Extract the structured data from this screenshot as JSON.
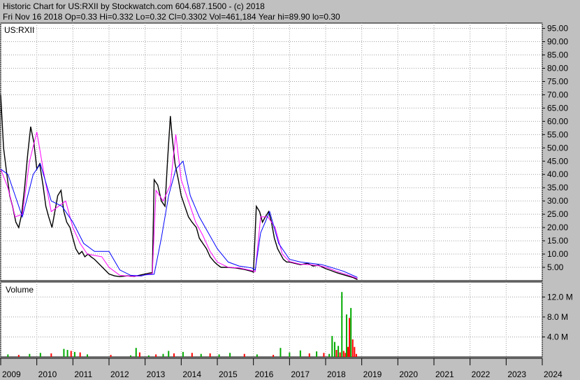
{
  "header": {
    "line1": "Historic Chart for US:RXII by Stockwatch.com 604.687.1500 - (c) 2018",
    "line2": "Fri Nov 16 2018  Op=0.33  Hi=0.332  Lo=0.32  Cl=0.3302  Vol=461,184  Year hi=89.90  lo=0.30"
  },
  "chart_data": [
    {
      "type": "line",
      "label": "US:RXII",
      "ylim": [
        0,
        97
      ],
      "y_ticks": [
        {
          "v": 95,
          "t": "95.00"
        },
        {
          "v": 90,
          "t": "90.00"
        },
        {
          "v": 85,
          "t": "85.00"
        },
        {
          "v": 80,
          "t": "80.00"
        },
        {
          "v": 75,
          "t": "75.00"
        },
        {
          "v": 70,
          "t": "70.00"
        },
        {
          "v": 65,
          "t": "65.00"
        },
        {
          "v": 60,
          "t": "60.00"
        },
        {
          "v": 55,
          "t": "55.00"
        },
        {
          "v": 50,
          "t": "50.00"
        },
        {
          "v": 45,
          "t": "45.00"
        },
        {
          "v": 40,
          "t": "40.00"
        },
        {
          "v": 35,
          "t": "35.00"
        },
        {
          "v": 30,
          "t": "30.00"
        },
        {
          "v": 25,
          "t": "25.00"
        },
        {
          "v": 20,
          "t": "20.00"
        },
        {
          "v": 15,
          "t": "15.00"
        },
        {
          "v": 10,
          "t": "10.00"
        },
        {
          "v": 5,
          "t": "5.00"
        }
      ],
      "grid": true,
      "xlim": [
        2009.0,
        2024.0
      ],
      "series": [
        {
          "role": "price",
          "color": "#000000",
          "x": [
            2009.0,
            2009.08,
            2009.17,
            2009.25,
            2009.33,
            2009.42,
            2009.5,
            2009.58,
            2009.67,
            2009.75,
            2009.83,
            2009.92,
            2010.0,
            2010.08,
            2010.17,
            2010.25,
            2010.33,
            2010.42,
            2010.5,
            2010.58,
            2010.67,
            2010.75,
            2010.83,
            2010.92,
            2011.0,
            2011.08,
            2011.17,
            2011.25,
            2011.33,
            2011.42,
            2011.5,
            2011.6,
            2012.0,
            2012.15,
            2012.3,
            2012.5,
            2012.7,
            2012.9,
            2013.0,
            2013.1,
            2013.2,
            2013.25,
            2013.35,
            2013.45,
            2013.55,
            2013.62,
            2013.7,
            2013.75,
            2013.83,
            2013.92,
            2014.0,
            2014.1,
            2014.2,
            2014.3,
            2014.42,
            2014.5,
            2014.6,
            2014.7,
            2014.8,
            2014.92,
            2015.0,
            2015.1,
            2015.25,
            2015.5,
            2015.75,
            2015.95,
            2016.0,
            2016.08,
            2016.17,
            2016.25,
            2016.33,
            2016.42,
            2016.5,
            2016.58,
            2016.67,
            2016.75,
            2016.83,
            2016.92,
            2017.0,
            2017.15,
            2017.3,
            2017.5,
            2017.65,
            2017.8,
            2017.92,
            2018.0,
            2018.15,
            2018.3,
            2018.45,
            2018.6,
            2018.75,
            2018.88
          ],
          "y": [
            70,
            50,
            40,
            32,
            28,
            22,
            20,
            25,
            36,
            48,
            58,
            52,
            42,
            44,
            36,
            28,
            24,
            20,
            26,
            32,
            34,
            26,
            22,
            20,
            16,
            12,
            10,
            11,
            9,
            10,
            9,
            8,
            2.5,
            1.8,
            1.5,
            1.8,
            1.6,
            2.2,
            2.5,
            2.8,
            3,
            38,
            36,
            30,
            28,
            45,
            62,
            54,
            44,
            38,
            32,
            28,
            24,
            22,
            20,
            16,
            14,
            12,
            9,
            7,
            6,
            5,
            5,
            4.8,
            4.2,
            3.5,
            3.2,
            28,
            26,
            22,
            24,
            26,
            22,
            16,
            12,
            10,
            8,
            7,
            7,
            6.5,
            6,
            6.5,
            5.5,
            5.8,
            5,
            4.5,
            3.8,
            3,
            2.4,
            1.8,
            1.2,
            0.4
          ]
        },
        {
          "role": "short-ma",
          "color": "#ff00ff",
          "x": [
            2009.0,
            2009.2,
            2009.4,
            2009.6,
            2009.8,
            2010.0,
            2010.2,
            2010.4,
            2010.6,
            2010.8,
            2011.0,
            2011.2,
            2011.4,
            2011.6,
            2011.8,
            2012.0,
            2012.3,
            2012.6,
            2012.9,
            2013.0,
            2013.2,
            2013.3,
            2013.5,
            2013.7,
            2013.85,
            2014.0,
            2014.2,
            2014.4,
            2014.6,
            2014.8,
            2015.0,
            2015.3,
            2015.6,
            2015.95,
            2016.05,
            2016.2,
            2016.4,
            2016.6,
            2016.8,
            2017.0,
            2017.3,
            2017.6,
            2017.9,
            2018.1,
            2018.3,
            2018.6,
            2018.88
          ],
          "y": [
            42,
            35,
            24,
            25,
            45,
            56,
            40,
            26,
            28,
            30,
            20,
            14,
            10,
            9.5,
            9,
            5,
            2,
            1.6,
            1.8,
            2.2,
            2.6,
            34,
            30,
            36,
            55,
            38,
            30,
            22,
            17,
            11,
            7,
            5,
            4.8,
            3.8,
            3.4,
            24,
            24,
            20,
            10,
            7.2,
            6.2,
            6,
            5.4,
            4.6,
            3.5,
            2.2,
            0.8
          ]
        },
        {
          "role": "long-ma",
          "color": "#0000ff",
          "x": [
            2009.0,
            2009.2,
            2009.4,
            2009.6,
            2009.9,
            2010.1,
            2010.4,
            2010.7,
            2011.0,
            2011.3,
            2011.6,
            2012.0,
            2012.3,
            2012.6,
            2012.9,
            2013.0,
            2013.25,
            2013.45,
            2013.65,
            2013.85,
            2014.05,
            2014.25,
            2014.5,
            2014.75,
            2015.0,
            2015.3,
            2015.6,
            2015.95,
            2016.05,
            2016.2,
            2016.45,
            2016.7,
            2017.0,
            2017.3,
            2017.6,
            2017.9,
            2018.2,
            2018.5,
            2018.88
          ],
          "y": [
            42,
            40,
            32,
            24,
            40,
            44,
            30,
            28,
            22,
            14,
            11,
            11,
            4,
            2,
            1.8,
            2.2,
            2.4,
            16,
            32,
            42,
            45,
            32,
            24,
            18,
            12,
            7,
            5.5,
            4.8,
            4,
            18,
            26,
            14,
            8,
            7,
            6.5,
            6,
            4.8,
            3.5,
            1.2
          ]
        }
      ]
    },
    {
      "type": "bar",
      "label": "Volume",
      "ylim": [
        0,
        15
      ],
      "y_ticks": [
        {
          "v": 12,
          "t": "12.0 M"
        },
        {
          "v": 8,
          "t": "8.0 M"
        },
        {
          "v": 4,
          "t": "4.0 M"
        }
      ],
      "up_color": "#00aa00",
      "down_color": "#ff0000",
      "xlim": [
        2009.0,
        2024.0
      ],
      "bars": {
        "x": [
          2009.2,
          2009.5,
          2009.8,
          2010.1,
          2010.4,
          2010.75,
          2010.85,
          2010.95,
          2011.05,
          2011.2,
          2011.4,
          2012.05,
          2012.6,
          2012.75,
          2012.85,
          2013.1,
          2013.3,
          2013.5,
          2013.65,
          2013.8,
          2014.05,
          2014.3,
          2014.55,
          2014.8,
          2015.05,
          2015.35,
          2015.75,
          2016.1,
          2016.55,
          2016.75,
          2017.0,
          2017.3,
          2017.55,
          2017.75,
          2017.95,
          2018.1,
          2018.18,
          2018.25,
          2018.3,
          2018.35,
          2018.4,
          2018.45,
          2018.5,
          2018.55,
          2018.58,
          2018.62,
          2018.66,
          2018.7,
          2018.75,
          2018.8,
          2018.85
        ],
        "values": [
          0.5,
          0.4,
          0.6,
          0.8,
          0.7,
          1.6,
          1.4,
          1.2,
          1.0,
          0.9,
          0.5,
          0.4,
          0.3,
          1.8,
          0.9,
          0.3,
          0.5,
          0.6,
          1.2,
          0.7,
          1.0,
          0.8,
          0.6,
          0.7,
          0.5,
          0.8,
          0.6,
          0.5,
          0.4,
          1.8,
          0.9,
          1.3,
          0.7,
          1.1,
          0.8,
          0.6,
          4.2,
          3.0,
          1.4,
          2.2,
          0.9,
          13.0,
          1.2,
          0.8,
          8.5,
          2.0,
          7.8,
          9.8,
          3.5,
          2.0,
          0.6
        ],
        "up": [
          true,
          false,
          true,
          true,
          false,
          true,
          true,
          false,
          true,
          false,
          true,
          false,
          true,
          true,
          false,
          true,
          false,
          true,
          true,
          false,
          true,
          false,
          true,
          false,
          true,
          true,
          false,
          true,
          false,
          true,
          true,
          true,
          false,
          true,
          false,
          true,
          true,
          true,
          false,
          true,
          false,
          true,
          false,
          false,
          true,
          false,
          false,
          true,
          false,
          false,
          false
        ]
      }
    }
  ],
  "x_axis_labels": [
    "2009",
    "2010",
    "2011",
    "2012",
    "2013",
    "2014",
    "2015",
    "2016",
    "2017",
    "2018",
    "2019",
    "2020",
    "2021",
    "2022",
    "2023",
    "2024"
  ]
}
